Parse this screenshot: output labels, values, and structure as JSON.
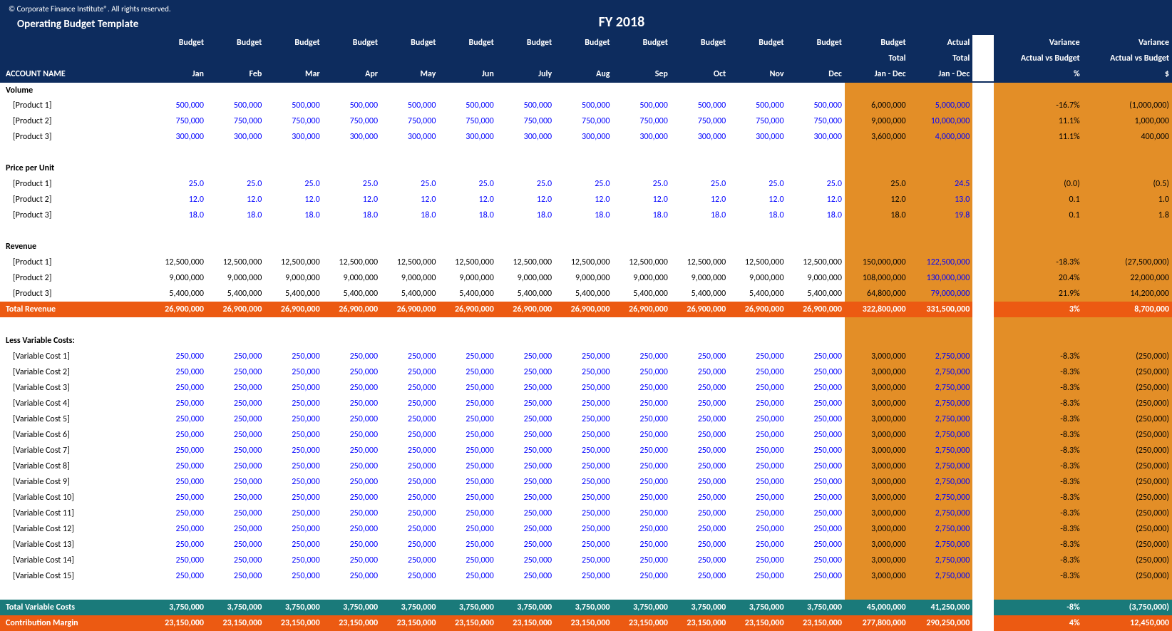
{
  "header": {
    "copyright": "© Corporate Finance Institute®. All rights reserved.",
    "template_name": "Operating Budget Template",
    "fiscal_year": "FY 2018"
  },
  "columns": {
    "account": "ACCOUNT NAME",
    "budget_label": "Budget",
    "months": [
      "Jan",
      "Feb",
      "Mar",
      "Apr",
      "May",
      "Jun",
      "July",
      "Aug",
      "Sep",
      "Oct",
      "Nov",
      "Dec"
    ],
    "budget_total_h1": "Budget",
    "budget_total_h2": "Total",
    "budget_total_h3": "Jan - Dec",
    "actual_total_h1": "Actual",
    "actual_total_h2": "Total",
    "actual_total_h3": "Jan - Dec",
    "var_pct_h1": "Variance",
    "var_pct_h2": "Actual vs Budget",
    "var_pct_h3": "%",
    "var_amt_h1": "Variance",
    "var_amt_h2": "Actual vs Budget",
    "var_amt_h3": "$"
  },
  "sections": [
    {
      "name": "Volume",
      "rows": [
        {
          "label": "[Product 1]",
          "m": [
            "500,000",
            "500,000",
            "500,000",
            "500,000",
            "500,000",
            "500,000",
            "500,000",
            "500,000",
            "500,000",
            "500,000",
            "500,000",
            "500,000"
          ],
          "bt": "6,000,000",
          "at": "5,000,000",
          "vp": "-16.7%",
          "va": "(1,000,000)",
          "cls": "blue",
          "tcls": "blk"
        },
        {
          "label": "[Product 2]",
          "m": [
            "750,000",
            "750,000",
            "750,000",
            "750,000",
            "750,000",
            "750,000",
            "750,000",
            "750,000",
            "750,000",
            "750,000",
            "750,000",
            "750,000"
          ],
          "bt": "9,000,000",
          "at": "10,000,000",
          "vp": "11.1%",
          "va": "1,000,000",
          "cls": "blue",
          "tcls": "blk"
        },
        {
          "label": "[Product 3]",
          "m": [
            "300,000",
            "300,000",
            "300,000",
            "300,000",
            "300,000",
            "300,000",
            "300,000",
            "300,000",
            "300,000",
            "300,000",
            "300,000",
            "300,000"
          ],
          "bt": "3,600,000",
          "at": "4,000,000",
          "vp": "11.1%",
          "va": "400,000",
          "cls": "blue",
          "tcls": "blk"
        }
      ]
    },
    {
      "name": "Price per Unit",
      "rows": [
        {
          "label": "[Product 1]",
          "m": [
            "25.0",
            "25.0",
            "25.0",
            "25.0",
            "25.0",
            "25.0",
            "25.0",
            "25.0",
            "25.0",
            "25.0",
            "25.0",
            "25.0"
          ],
          "bt": "25.0",
          "at": "24.5",
          "vp": "(0.0)",
          "va": "(0.5)",
          "cls": "blue",
          "tcls": "blk"
        },
        {
          "label": "[Product 2]",
          "m": [
            "12.0",
            "12.0",
            "12.0",
            "12.0",
            "12.0",
            "12.0",
            "12.0",
            "12.0",
            "12.0",
            "12.0",
            "12.0",
            "12.0"
          ],
          "bt": "12.0",
          "at": "13.0",
          "vp": "0.1",
          "va": "1.0",
          "cls": "blue",
          "tcls": "blk"
        },
        {
          "label": "[Product 3]",
          "m": [
            "18.0",
            "18.0",
            "18.0",
            "18.0",
            "18.0",
            "18.0",
            "18.0",
            "18.0",
            "18.0",
            "18.0",
            "18.0",
            "18.0"
          ],
          "bt": "18.0",
          "at": "19.8",
          "vp": "0.1",
          "va": "1.8",
          "cls": "blue",
          "tcls": "blk"
        }
      ]
    },
    {
      "name": "Revenue",
      "rows": [
        {
          "label": "[Product 1]",
          "m": [
            "12,500,000",
            "12,500,000",
            "12,500,000",
            "12,500,000",
            "12,500,000",
            "12,500,000",
            "12,500,000",
            "12,500,000",
            "12,500,000",
            "12,500,000",
            "12,500,000",
            "12,500,000"
          ],
          "bt": "150,000,000",
          "at": "122,500,000",
          "vp": "-18.3%",
          "va": "(27,500,000)",
          "cls": "blk",
          "tcls": "blk"
        },
        {
          "label": "[Product 2]",
          "m": [
            "9,000,000",
            "9,000,000",
            "9,000,000",
            "9,000,000",
            "9,000,000",
            "9,000,000",
            "9,000,000",
            "9,000,000",
            "9,000,000",
            "9,000,000",
            "9,000,000",
            "9,000,000"
          ],
          "bt": "108,000,000",
          "at": "130,000,000",
          "vp": "20.4%",
          "va": "22,000,000",
          "cls": "blk",
          "tcls": "blk"
        },
        {
          "label": "[Product 3]",
          "m": [
            "5,400,000",
            "5,400,000",
            "5,400,000",
            "5,400,000",
            "5,400,000",
            "5,400,000",
            "5,400,000",
            "5,400,000",
            "5,400,000",
            "5,400,000",
            "5,400,000",
            "5,400,000"
          ],
          "bt": "64,800,000",
          "at": "79,000,000",
          "vp": "21.9%",
          "va": "14,200,000",
          "cls": "blk",
          "tcls": "blk"
        }
      ]
    }
  ],
  "total_revenue": {
    "label": "Total Revenue",
    "m": [
      "26,900,000",
      "26,900,000",
      "26,900,000",
      "26,900,000",
      "26,900,000",
      "26,900,000",
      "26,900,000",
      "26,900,000",
      "26,900,000",
      "26,900,000",
      "26,900,000",
      "26,900,000"
    ],
    "bt": "322,800,000",
    "at": "331,500,000",
    "vp": "3%",
    "va": "8,700,000"
  },
  "variable_costs": {
    "header": "Less Variable Costs:",
    "rows": [
      {
        "label": "[Variable Cost 1]",
        "m": [
          "250,000",
          "250,000",
          "250,000",
          "250,000",
          "250,000",
          "250,000",
          "250,000",
          "250,000",
          "250,000",
          "250,000",
          "250,000",
          "250,000"
        ],
        "bt": "3,000,000",
        "at": "2,750,000",
        "vp": "-8.3%",
        "va": "(250,000)"
      },
      {
        "label": "[Variable Cost 2]",
        "m": [
          "250,000",
          "250,000",
          "250,000",
          "250,000",
          "250,000",
          "250,000",
          "250,000",
          "250,000",
          "250,000",
          "250,000",
          "250,000",
          "250,000"
        ],
        "bt": "3,000,000",
        "at": "2,750,000",
        "vp": "-8.3%",
        "va": "(250,000)"
      },
      {
        "label": "[Variable Cost 3]",
        "m": [
          "250,000",
          "250,000",
          "250,000",
          "250,000",
          "250,000",
          "250,000",
          "250,000",
          "250,000",
          "250,000",
          "250,000",
          "250,000",
          "250,000"
        ],
        "bt": "3,000,000",
        "at": "2,750,000",
        "vp": "-8.3%",
        "va": "(250,000)"
      },
      {
        "label": "[Variable Cost 4]",
        "m": [
          "250,000",
          "250,000",
          "250,000",
          "250,000",
          "250,000",
          "250,000",
          "250,000",
          "250,000",
          "250,000",
          "250,000",
          "250,000",
          "250,000"
        ],
        "bt": "3,000,000",
        "at": "2,750,000",
        "vp": "-8.3%",
        "va": "(250,000)"
      },
      {
        "label": "[Variable Cost 5]",
        "m": [
          "250,000",
          "250,000",
          "250,000",
          "250,000",
          "250,000",
          "250,000",
          "250,000",
          "250,000",
          "250,000",
          "250,000",
          "250,000",
          "250,000"
        ],
        "bt": "3,000,000",
        "at": "2,750,000",
        "vp": "-8.3%",
        "va": "(250,000)"
      },
      {
        "label": "[Variable Cost 6]",
        "m": [
          "250,000",
          "250,000",
          "250,000",
          "250,000",
          "250,000",
          "250,000",
          "250,000",
          "250,000",
          "250,000",
          "250,000",
          "250,000",
          "250,000"
        ],
        "bt": "3,000,000",
        "at": "2,750,000",
        "vp": "-8.3%",
        "va": "(250,000)"
      },
      {
        "label": "[Variable Cost 7]",
        "m": [
          "250,000",
          "250,000",
          "250,000",
          "250,000",
          "250,000",
          "250,000",
          "250,000",
          "250,000",
          "250,000",
          "250,000",
          "250,000",
          "250,000"
        ],
        "bt": "3,000,000",
        "at": "2,750,000",
        "vp": "-8.3%",
        "va": "(250,000)"
      },
      {
        "label": "[Variable Cost 8]",
        "m": [
          "250,000",
          "250,000",
          "250,000",
          "250,000",
          "250,000",
          "250,000",
          "250,000",
          "250,000",
          "250,000",
          "250,000",
          "250,000",
          "250,000"
        ],
        "bt": "3,000,000",
        "at": "2,750,000",
        "vp": "-8.3%",
        "va": "(250,000)"
      },
      {
        "label": "[Variable Cost 9]",
        "m": [
          "250,000",
          "250,000",
          "250,000",
          "250,000",
          "250,000",
          "250,000",
          "250,000",
          "250,000",
          "250,000",
          "250,000",
          "250,000",
          "250,000"
        ],
        "bt": "3,000,000",
        "at": "2,750,000",
        "vp": "-8.3%",
        "va": "(250,000)"
      },
      {
        "label": "[Variable Cost 10]",
        "m": [
          "250,000",
          "250,000",
          "250,000",
          "250,000",
          "250,000",
          "250,000",
          "250,000",
          "250,000",
          "250,000",
          "250,000",
          "250,000",
          "250,000"
        ],
        "bt": "3,000,000",
        "at": "2,750,000",
        "vp": "-8.3%",
        "va": "(250,000)"
      },
      {
        "label": "[Variable Cost 11]",
        "m": [
          "250,000",
          "250,000",
          "250,000",
          "250,000",
          "250,000",
          "250,000",
          "250,000",
          "250,000",
          "250,000",
          "250,000",
          "250,000",
          "250,000"
        ],
        "bt": "3,000,000",
        "at": "2,750,000",
        "vp": "-8.3%",
        "va": "(250,000)"
      },
      {
        "label": "[Variable Cost 12]",
        "m": [
          "250,000",
          "250,000",
          "250,000",
          "250,000",
          "250,000",
          "250,000",
          "250,000",
          "250,000",
          "250,000",
          "250,000",
          "250,000",
          "250,000"
        ],
        "bt": "3,000,000",
        "at": "2,750,000",
        "vp": "-8.3%",
        "va": "(250,000)"
      },
      {
        "label": "[Variable Cost 13]",
        "m": [
          "250,000",
          "250,000",
          "250,000",
          "250,000",
          "250,000",
          "250,000",
          "250,000",
          "250,000",
          "250,000",
          "250,000",
          "250,000",
          "250,000"
        ],
        "bt": "3,000,000",
        "at": "2,750,000",
        "vp": "-8.3%",
        "va": "(250,000)"
      },
      {
        "label": "[Variable Cost 14]",
        "m": [
          "250,000",
          "250,000",
          "250,000",
          "250,000",
          "250,000",
          "250,000",
          "250,000",
          "250,000",
          "250,000",
          "250,000",
          "250,000",
          "250,000"
        ],
        "bt": "3,000,000",
        "at": "2,750,000",
        "vp": "-8.3%",
        "va": "(250,000)"
      },
      {
        "label": "[Variable Cost 15]",
        "m": [
          "250,000",
          "250,000",
          "250,000",
          "250,000",
          "250,000",
          "250,000",
          "250,000",
          "250,000",
          "250,000",
          "250,000",
          "250,000",
          "250,000"
        ],
        "bt": "3,000,000",
        "at": "2,750,000",
        "vp": "-8.3%",
        "va": "(250,000)"
      }
    ]
  },
  "total_variable": {
    "label": "Total Variable Costs",
    "m": [
      "3,750,000",
      "3,750,000",
      "3,750,000",
      "3,750,000",
      "3,750,000",
      "3,750,000",
      "3,750,000",
      "3,750,000",
      "3,750,000",
      "3,750,000",
      "3,750,000",
      "3,750,000"
    ],
    "bt": "45,000,000",
    "at": "41,250,000",
    "vp": "-8%",
    "va": "(3,750,000)"
  },
  "contribution_margin": {
    "label": "Contribution Margin",
    "m": [
      "23,150,000",
      "23,150,000",
      "23,150,000",
      "23,150,000",
      "23,150,000",
      "23,150,000",
      "23,150,000",
      "23,150,000",
      "23,150,000",
      "23,150,000",
      "23,150,000",
      "23,150,000"
    ],
    "bt": "277,800,000",
    "at": "290,250,000",
    "vp": "4%",
    "va": "12,450,000"
  }
}
